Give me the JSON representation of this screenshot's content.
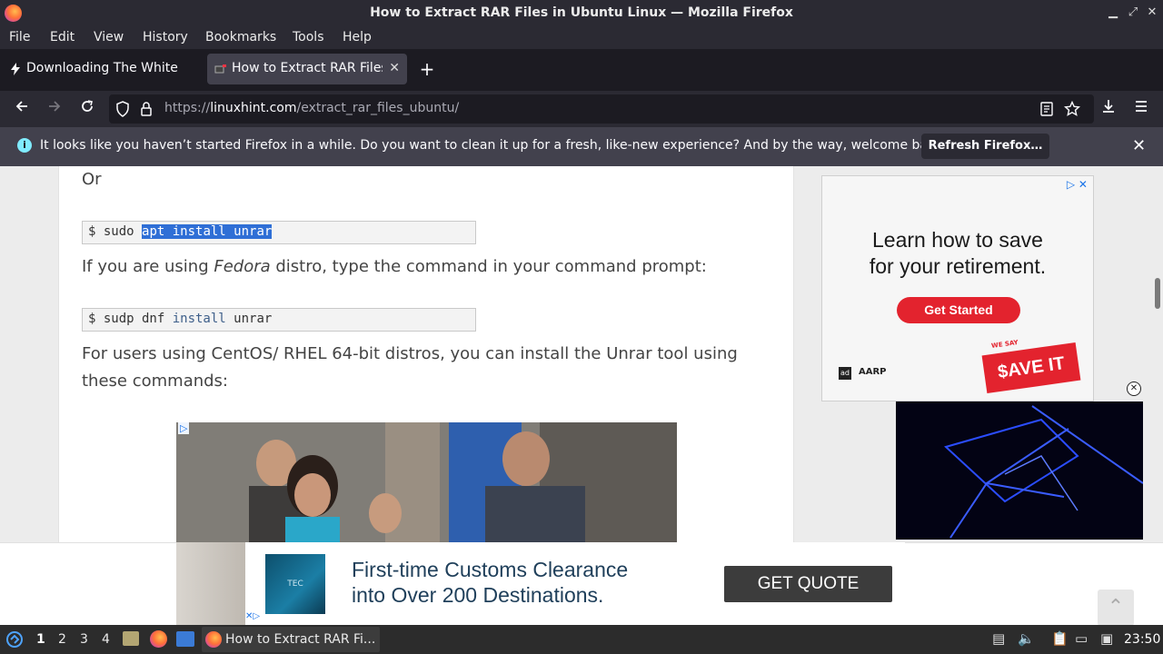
{
  "window": {
    "title": "How to Extract RAR Files in Ubuntu Linux — Mozilla Firefox",
    "minimize_glyph": "▁",
    "maximize_glyph": "⤢",
    "close_glyph": "✕"
  },
  "menubar": {
    "items": [
      "File",
      "Edit",
      "View",
      "History",
      "Bookmarks",
      "Tools",
      "Help"
    ]
  },
  "tabs": [
    {
      "label": "Downloading The White House",
      "icon": "lightning-icon",
      "active": false
    },
    {
      "label": "How to Extract RAR Files in Ubuntu Linux",
      "icon": "linuxhint-favicon",
      "active": true
    }
  ],
  "newtab_glyph": "+",
  "navbar": {
    "url_prefix": "https://",
    "url_domain": "linuxhint.com",
    "url_path": "/extract_rar_files_ubuntu/"
  },
  "notification": {
    "message": "It looks like you haven’t started Firefox in a while. Do you want to clean it up for a fresh, like-new experience? And by the way, welcome back!",
    "button": "Refresh Firefox…"
  },
  "article": {
    "or_text": "Or",
    "cmd1_prompt": "$ sudo ",
    "cmd1_selected": "apt install unrar",
    "para_fedora_before": "If you are using ",
    "para_fedora_em": "Fedora",
    "para_fedora_after": " distro, type the command in your command prompt:",
    "cmd2_prefix": "$ sudp dnf ",
    "cmd2_kw": "install",
    "cmd2_rest": " unrar",
    "para_centos_line1": "For users using CentOS/ RHEL 64-bit distros, you can install the Unrar tool using",
    "para_centos_line2": "these commands:"
  },
  "side_ad": {
    "headline_line1": "Learn how to save",
    "headline_line2": "for your retirement.",
    "button": "Get Started",
    "sponsor": "AARP",
    "badge": "$AVE IT",
    "badge_top": "WE SAY",
    "ad_chip": "ad"
  },
  "banner_ad": {
    "line1": "First-time Customs Clearance",
    "line2": "into Over 200 Destinations.",
    "button": "GET QUOTE",
    "logo_text": "TEC"
  },
  "taskbar": {
    "workspaces": [
      "1",
      "2",
      "3",
      "4"
    ],
    "active_workspace": "1",
    "task_label": "How to Extract RAR Fi...",
    "clock": "23:50"
  },
  "colors": {
    "accent_selection": "#2f6fd6",
    "notification_bg": "#42414d",
    "ad_red": "#e3232e"
  }
}
